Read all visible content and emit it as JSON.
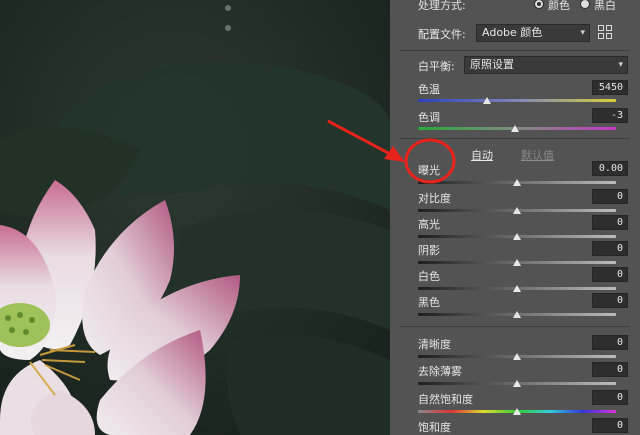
{
  "panel": {
    "process": {
      "label": "处理方式:",
      "options": [
        "颜色",
        "黑白"
      ],
      "selected": 0
    },
    "profile": {
      "label": "配置文件:",
      "value": "Adobe 颜色",
      "chevron": "▾"
    },
    "white_balance": {
      "label": "白平衡:",
      "value": "原照设置",
      "chevron": "▾"
    },
    "temp": {
      "label": "色温",
      "value": "5450",
      "level": 0.35
    },
    "tint": {
      "label": "色调",
      "value": "-3",
      "level": 0.49
    },
    "links": {
      "auto": "自动",
      "default": "默认值"
    },
    "sliders": [
      {
        "key": "exposure",
        "label": "曝光",
        "value": "0.00",
        "level": 0.5
      },
      {
        "key": "contrast",
        "label": "对比度",
        "value": "0",
        "level": 0.5
      },
      {
        "key": "highlights",
        "label": "高光",
        "value": "0",
        "level": 0.5
      },
      {
        "key": "shadows",
        "label": "阴影",
        "value": "0",
        "level": 0.5
      },
      {
        "key": "whites",
        "label": "白色",
        "value": "0",
        "level": 0.5
      },
      {
        "key": "blacks",
        "label": "黑色",
        "value": "0",
        "level": 0.5
      },
      {
        "key": "clarity",
        "label": "清晰度",
        "value": "0",
        "level": 0.5
      },
      {
        "key": "dehaze",
        "label": "去除薄雾",
        "value": "0",
        "level": 0.5
      },
      {
        "key": "vibrance",
        "label": "自然饱和度",
        "value": "0",
        "level": 0.5
      },
      {
        "key": "saturation",
        "label": "饱和度",
        "value": "0",
        "level": 0.5
      }
    ]
  },
  "annotation": {
    "arrow_color": "#e8231c",
    "circle_color": "#e8231c"
  }
}
